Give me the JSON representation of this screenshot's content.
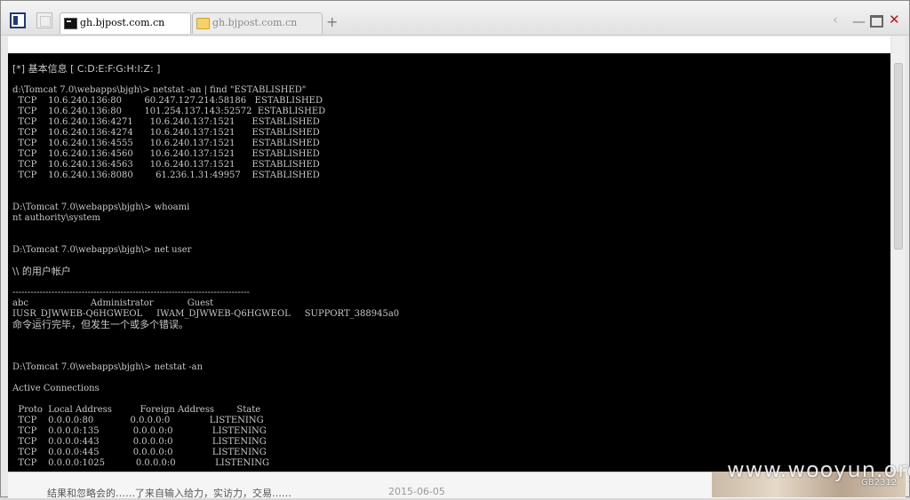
{
  "browser": {
    "tabs": [
      {
        "label": "gh.bjpost.com.cn",
        "icon": "terminal-icon",
        "active": true
      },
      {
        "label": "gh.bjpost.com.cn",
        "icon": "folder-icon",
        "active": false
      }
    ],
    "new_tab_label": "+",
    "controls": {
      "back": "‹",
      "minimize": "—",
      "close": "✕"
    }
  },
  "terminal": {
    "lines": [
      "[*] 基本信息 [ C:D:E:F:G:H:I:Z: ]",
      "",
      "d:\\Tomcat 7.0\\webapps\\bjgh\\> netstat -an | find \"ESTABLISHED\"",
      "  TCP    10.6.240.136:80        60.247.127.214:58186   ESTABLISHED",
      "  TCP    10.6.240.136:80        101.254.137.143:52572  ESTABLISHED",
      "  TCP    10.6.240.136:4271      10.6.240.137:1521      ESTABLISHED",
      "  TCP    10.6.240.136:4274      10.6.240.137:1521      ESTABLISHED",
      "  TCP    10.6.240.136:4555      10.6.240.137:1521      ESTABLISHED",
      "  TCP    10.6.240.136:4560      10.6.240.137:1521      ESTABLISHED",
      "  TCP    10.6.240.136:4563      10.6.240.137:1521      ESTABLISHED",
      "  TCP    10.6.240.136:8080        61.236.1.31:49957    ESTABLISHED",
      "",
      "",
      "D:\\Tomcat 7.0\\webapps\\bjgh\\> whoami",
      "nt authority\\system",
      "",
      "",
      "D:\\Tomcat 7.0\\webapps\\bjgh\\> net user",
      "",
      "\\\\ 的用户帐户",
      "",
      "-------------------------------------------------------------------------------",
      "abc                      Administrator            Guest",
      "IUSR_DJWWEB-Q6HGWEOL     IWAM_DJWWEB-Q6HGWEOL     SUPPORT_388945a0",
      "命令运行完毕，但发生一个或多个错误。",
      "",
      "",
      "",
      "D:\\Tomcat 7.0\\webapps\\bjgh\\> netstat -an",
      "",
      "Active Connections",
      "",
      "  Proto  Local Address          Foreign Address        State",
      "  TCP    0.0.0.0:80             0.0.0.0:0              LISTENING",
      "  TCP    0.0.0.0:135            0.0.0.0:0              LISTENING",
      "  TCP    0.0.0.0:443            0.0.0.0:0              LISTENING",
      "  TCP    0.0.0.0:445            0.0.0.0:0              LISTENING",
      "  TCP    0.0.0.0:1025           0.0.0.0:0              LISTENING"
    ]
  },
  "page_below": {
    "text": "结果和忽略会的……了来自输入给力，实访力，交易……",
    "date": "2015-06-05"
  },
  "watermark": "www.wooyun.org",
  "watermark_tag": "GB2312"
}
